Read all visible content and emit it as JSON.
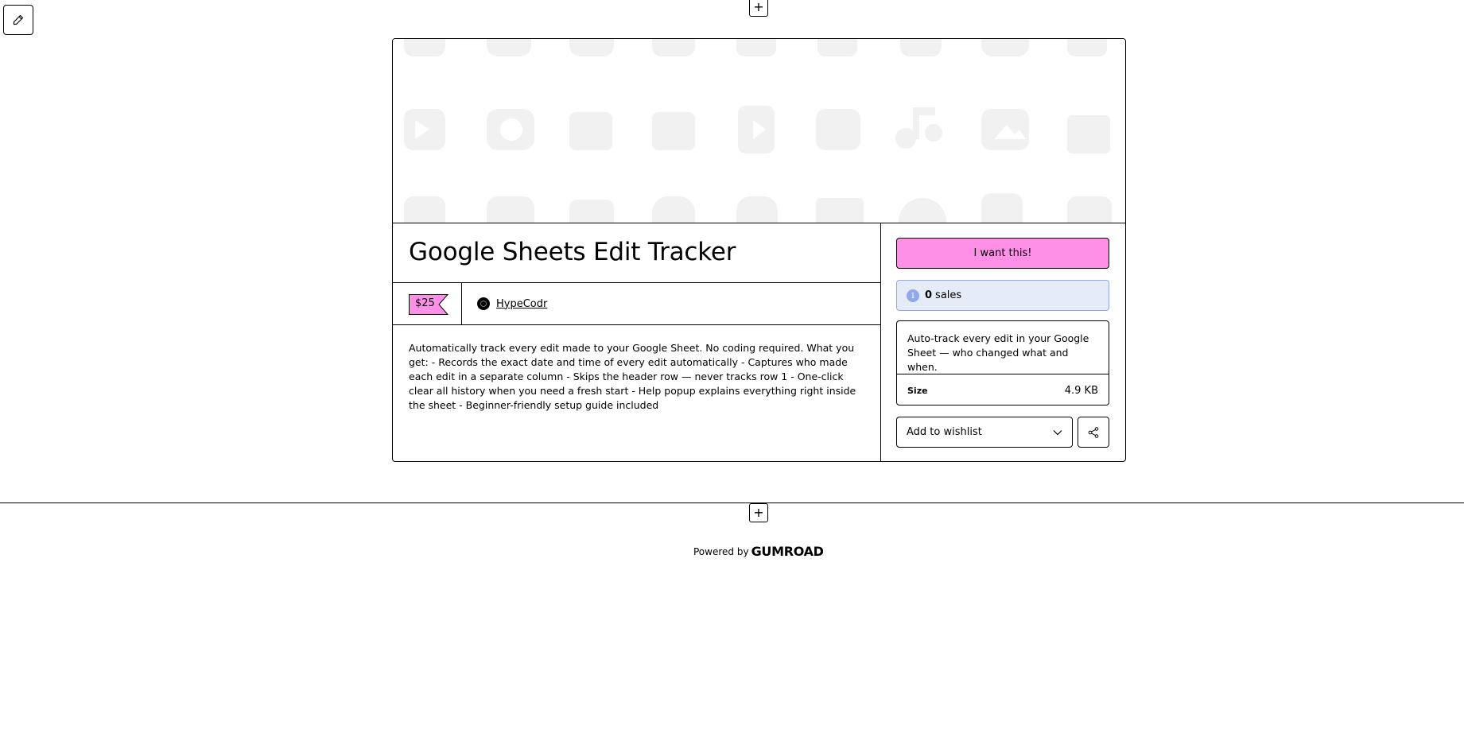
{
  "product": {
    "title": "Google Sheets Edit Tracker",
    "price": "$25",
    "author": "HypeCodr",
    "description": "Automatically track every edit made to your Google Sheet. No coding required. What you get: - Records the exact date and time of every edit automatically - Captures who made each edit in a separate column - Skips the header row — never tracks row 1 - One-click clear all history when you need a fresh start - Help popup explains everything right inside the sheet - Beginner-friendly setup guide included",
    "summary": "Auto-track every edit in your Google Sheet — who changed what and when.",
    "size_label": "Size",
    "size_value": "4.9 KB"
  },
  "actions": {
    "buy_label": "I want this!",
    "sales_count": "0",
    "sales_label": "sales",
    "wishlist_label": "Add to wishlist"
  },
  "footer": {
    "powered_by": "Powered by",
    "brand": "GUMROAD"
  },
  "colors": {
    "accent_pink": "#ff90e8",
    "info_blue": "#90a8ed",
    "info_bg": "#e6ebf8"
  }
}
